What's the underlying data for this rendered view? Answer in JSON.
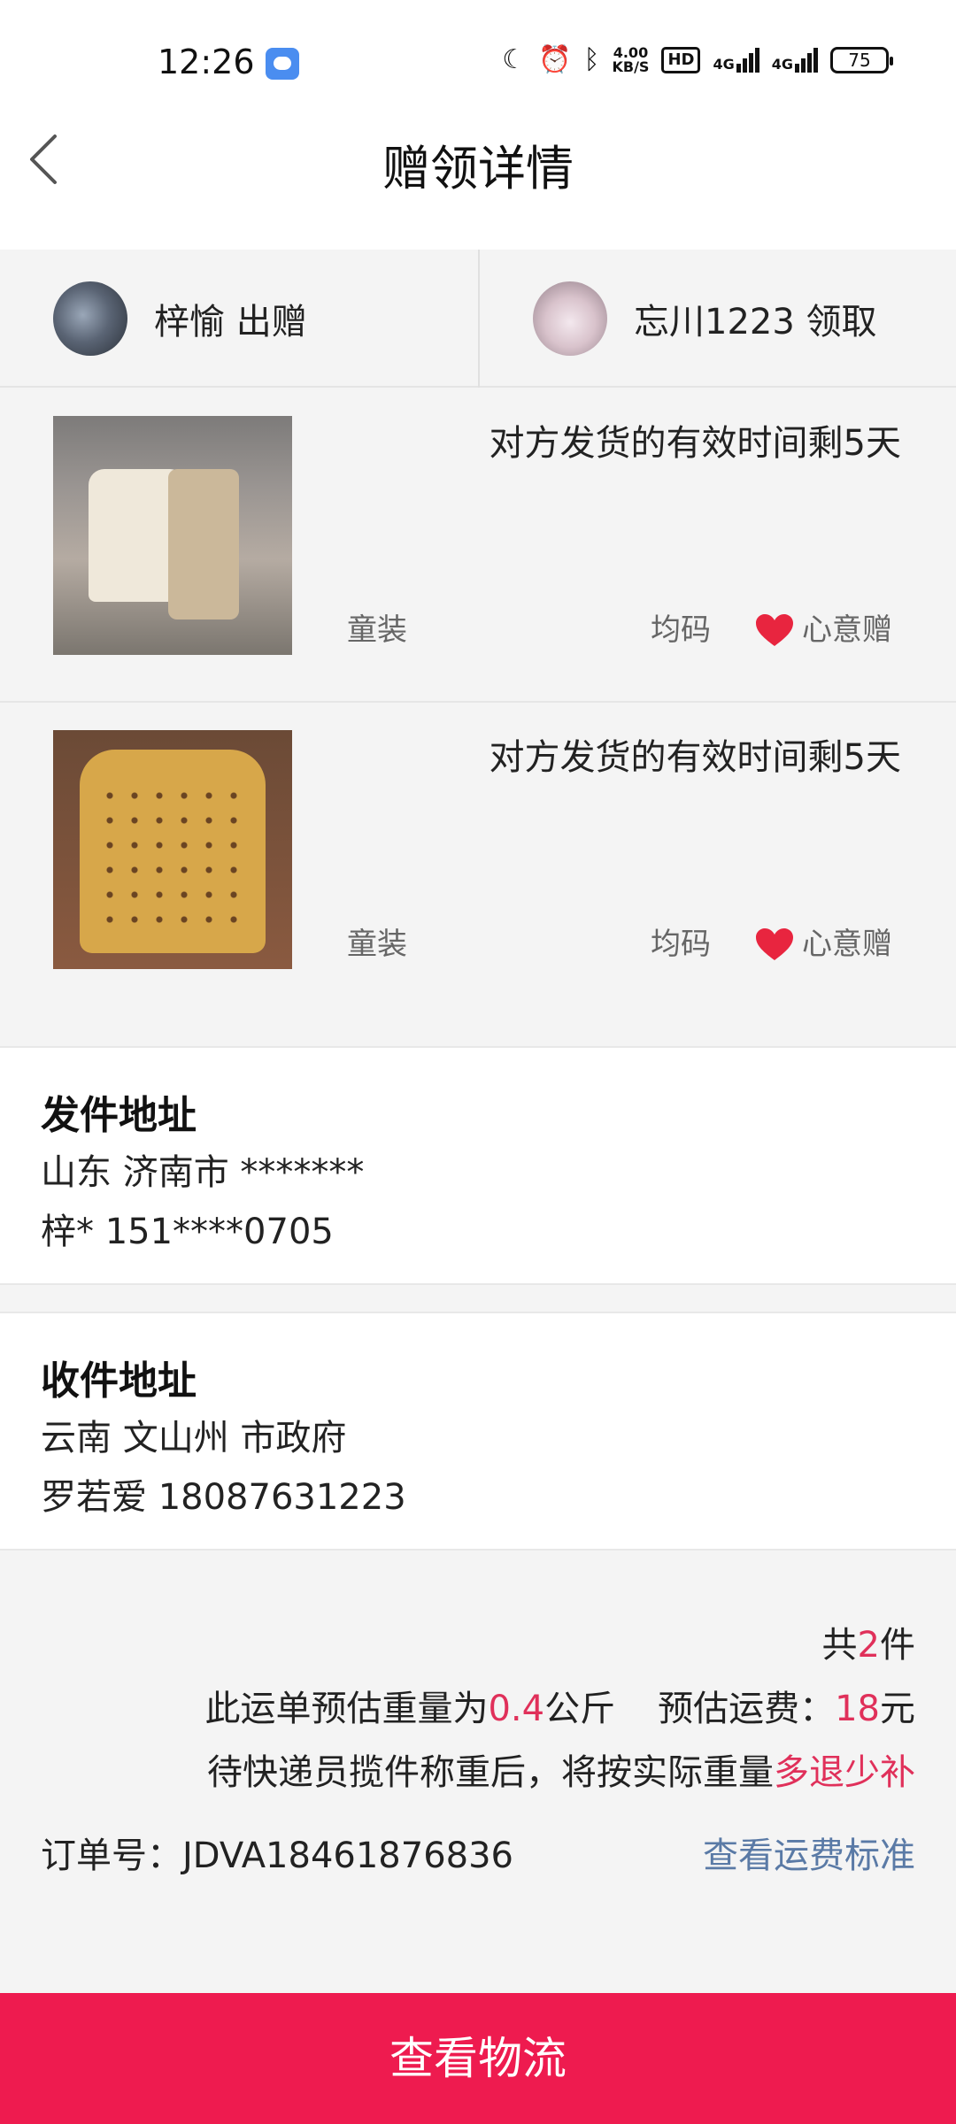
{
  "status_bar": {
    "time": "12:26",
    "speed_value": "4.00",
    "speed_unit": "KB/S",
    "hd_label": "HD",
    "signal_1": "4G",
    "signal_2": "4G",
    "battery": "75"
  },
  "header": {
    "title": "赠领详情"
  },
  "users": {
    "giver_name": "梓愉 出赠",
    "receiver_name": "忘川1223 领取"
  },
  "items": [
    {
      "deadline": "对方发货的有效时间剩5天",
      "category": "童装",
      "size": "均码",
      "type": "心意赠"
    },
    {
      "deadline": "对方发货的有效时间剩5天",
      "category": "童装",
      "size": "均码",
      "type": "心意赠"
    }
  ],
  "sender_address": {
    "title": "发件地址",
    "line1": "山东 济南市 *******",
    "line2": "梓* 151****0705"
  },
  "receiver_address": {
    "title": "收件地址",
    "line1": "云南 文山州 市政府",
    "line2": "罗若爱 18087631223"
  },
  "summary": {
    "count_prefix": "共",
    "count": "2",
    "count_suffix": "件",
    "weight_prefix": "此运单预估重量为",
    "weight": "0.4",
    "weight_unit": "公斤",
    "fee_prefix": "预估运费：",
    "fee": "18",
    "fee_unit": "元",
    "note_prefix": "待快递员揽件称重后，将按实际重量",
    "note_highlight": "多退少补",
    "order_label": "订单号：JDVA18461876836",
    "fee_link": "查看运费标准"
  },
  "bottom": {
    "button_label": "查看物流"
  },
  "colors": {
    "accent": "#ee1b4f",
    "highlight": "#e0305a",
    "link": "#5a7aa6"
  }
}
